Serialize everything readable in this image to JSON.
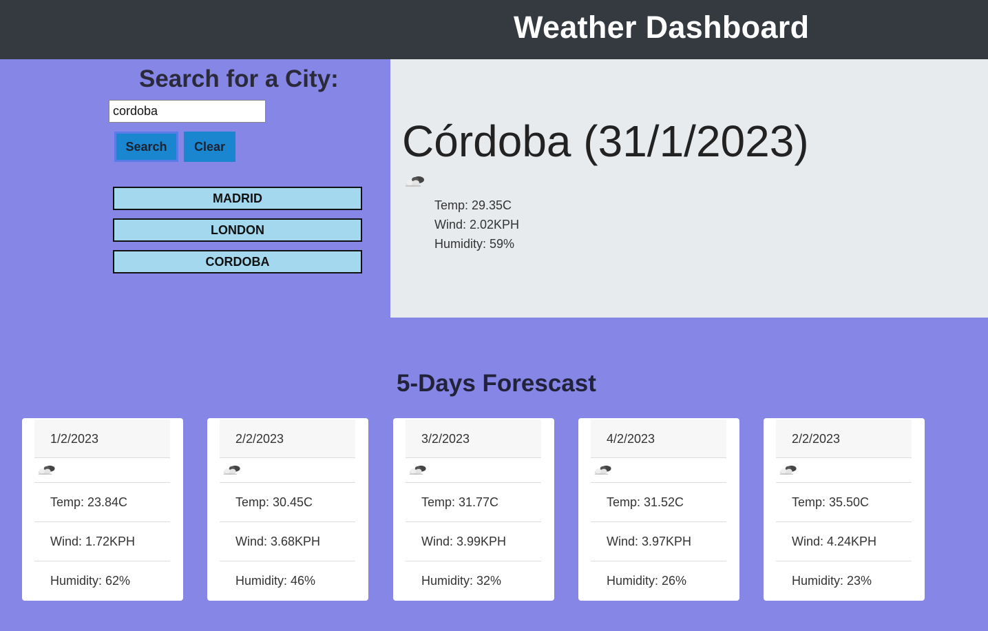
{
  "header": {
    "title": "Weather Dashboard",
    "background_color": "#343a40"
  },
  "search": {
    "heading": "Search for a City:",
    "input_value": "cordoba",
    "search_label": "Search",
    "clear_label": "Clear",
    "button_color": "#1a86d0",
    "history": [
      "MADRID",
      "LONDON",
      "CORDOBA"
    ],
    "history_color": "#a3d8ee"
  },
  "current": {
    "title": "Córdoba (31/1/2023)",
    "icon": "cloud-icon",
    "temp": "Temp: 29.35C",
    "wind": "Wind: 2.02KPH",
    "humidity": "Humidity: 59%"
  },
  "forecast": {
    "heading": "5-Days Forescast",
    "cards": [
      {
        "date": "1/2/2023",
        "icon": "cloud-icon",
        "temp": "Temp: 23.84C",
        "wind": "Wind: 1.72KPH",
        "humidity": "Humidity: 62%"
      },
      {
        "date": "2/2/2023",
        "icon": "cloud-icon",
        "temp": "Temp: 30.45C",
        "wind": "Wind: 3.68KPH",
        "humidity": "Humidity: 46%"
      },
      {
        "date": "3/2/2023",
        "icon": "cloud-icon",
        "temp": "Temp: 31.77C",
        "wind": "Wind: 3.99KPH",
        "humidity": "Humidity: 32%"
      },
      {
        "date": "4/2/2023",
        "icon": "cloud-icon",
        "temp": "Temp: 31.52C",
        "wind": "Wind: 3.97KPH",
        "humidity": "Humidity: 26%"
      },
      {
        "date": "2/2/2023",
        "icon": "cloud-icon",
        "temp": "Temp: 35.50C",
        "wind": "Wind: 4.24KPH",
        "humidity": "Humidity: 23%"
      }
    ]
  },
  "colors": {
    "page_background": "#8686e6",
    "current_panel": "#e8ebee",
    "card_background": "#ffffff"
  }
}
